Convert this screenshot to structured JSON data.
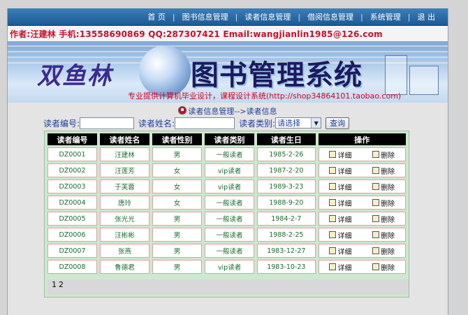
{
  "nav": {
    "items": [
      "首 页",
      "图书信息管理",
      "读者信息管理",
      "借阅信息管理",
      "系统管理",
      "退 出"
    ],
    "separator": "|"
  },
  "author_line": "作者:汪建林  手机:13558690869 QQ:287307421 Email:wangjianlin1985@126.com",
  "banner": {
    "brand": "双鱼林",
    "system": "图书管理系统",
    "tagline": "专业提供计算机毕业设计，课程设计系统(http://shop34864101.taobao.com)"
  },
  "breadcrumb": "读者信息管理-->读者信息",
  "search": {
    "reader_no_label": "读者编号:",
    "reader_no_value": "",
    "reader_name_label": "读者姓名:",
    "reader_name_value": "",
    "reader_type_label": "读者类别:",
    "reader_type_selected": "请选择",
    "query_button": "查询"
  },
  "table": {
    "headers": [
      "读者编号",
      "读者姓名",
      "读者性别",
      "读者类别",
      "读者生日",
      "操作"
    ],
    "detail_label": "详细",
    "delete_label": "删除",
    "rows": [
      [
        "DZ0001",
        "汪建林",
        "男",
        "一般读者",
        "1985-2-26"
      ],
      [
        "DZ0002",
        "汪莲芳",
        "女",
        "vip读者",
        "1987-2-20"
      ],
      [
        "DZ0003",
        "于芙蓉",
        "女",
        "vip读者",
        "1989-3-23"
      ],
      [
        "DZ0004",
        "唐玲",
        "女",
        "一般读者",
        "1988-9-20"
      ],
      [
        "DZ0005",
        "张光光",
        "男",
        "一般读者",
        "1984-2-7"
      ],
      [
        "DZ0006",
        "汪彬彬",
        "男",
        "一般读者",
        "1988-2-25"
      ],
      [
        "DZ0007",
        "张燕",
        "男",
        "一般读者",
        "1983-12-27"
      ],
      [
        "DZ0008",
        "鲁德君",
        "男",
        "vip读者",
        "1983-10-23"
      ]
    ]
  },
  "pager": {
    "pages": [
      "1",
      "2"
    ]
  },
  "colors": {
    "nav_bg": "#2a6aa8",
    "author_text": "#c8102e",
    "cell_text": "#1b6b2b",
    "header_bg": "#000000"
  }
}
